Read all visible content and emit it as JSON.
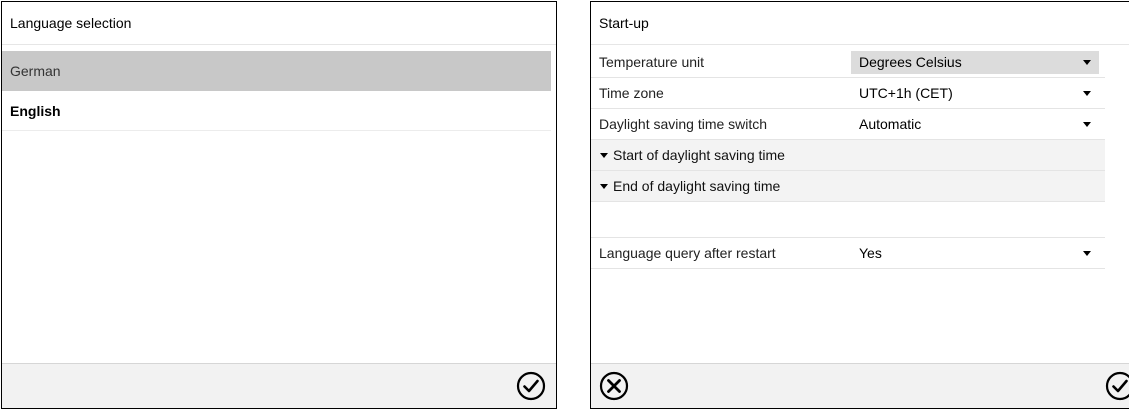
{
  "left_panel": {
    "title": "Language selection",
    "items": [
      {
        "label": "German",
        "state": "highlighted"
      },
      {
        "label": "English",
        "state": "current"
      }
    ],
    "confirm_icon": "check-circle-icon"
  },
  "right_panel": {
    "title": "Start-up",
    "temperature_unit": {
      "label": "Temperature unit",
      "value": "Degrees Celsius"
    },
    "time_zone": {
      "label": "Time zone",
      "value": "UTC+1h (CET)"
    },
    "dst_switch": {
      "label": "Daylight saving time switch",
      "value": "Automatic"
    },
    "dst_start": {
      "label": "Start of daylight saving time"
    },
    "dst_end": {
      "label": "End of daylight saving time"
    },
    "language_query": {
      "label": "Language query after restart",
      "value": "Yes"
    },
    "cancel_icon": "x-circle-icon",
    "confirm_icon": "check-circle-icon"
  }
}
